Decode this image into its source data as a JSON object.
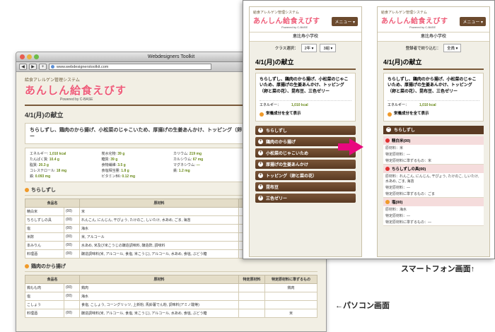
{
  "desktop": {
    "window_title": "Webdesigners Toolkit",
    "url": "www.webdesignerstoolkit.com",
    "logo_top": "給食アレルゲン管理システム",
    "logo": "あんしん給食えびす",
    "powered": "Powered by C-BASE",
    "headline": "4/1(月)の献立",
    "menu_text": "ちらしずし、鶏肉のから揚げ、小松菜のじゃこいため、厚揚げの生姜あんかけ、トッピング（卵と菜の花）、昆布豆、三色ゼリー",
    "nutrition": [
      {
        "label": "エネルギー:",
        "value": "1,010 kcal"
      },
      {
        "label": "炭水化物:",
        "value": "39 g"
      },
      {
        "label": "カリウム:",
        "value": "219 mg"
      },
      {
        "label": "ビタミンA当量:",
        "value": "175 IU"
      },
      {
        "label": "たんぱく質:",
        "value": "10.4 g"
      },
      {
        "label": "糖質:",
        "value": "39 g"
      },
      {
        "label": "カルシウム:",
        "value": "67 mg"
      },
      {
        "label": "ビタミンD:",
        "value": "6 IU"
      },
      {
        "label": "脂質:",
        "value": "20.3 g"
      },
      {
        "label": "食物繊維:",
        "value": "3.5 g"
      },
      {
        "label": "マグネシウム:",
        "value": "—"
      },
      {
        "label": "ビタミンB1:",
        "value": "0.23 mg"
      },
      {
        "label": "コレステロール:",
        "value": "18 mg"
      },
      {
        "label": "食塩相当量:",
        "value": "1.8 g"
      },
      {
        "label": "鉄:",
        "value": "1.2 mg"
      },
      {
        "label": "ビタミンB2:",
        "value": "0.11 mg"
      },
      {
        "label": "鉄:",
        "value": "0.093 mg"
      },
      {
        "label": "ビタミンB6:",
        "value": "0.12 mg"
      }
    ],
    "section1": "ちらしずし",
    "section2": "鶏肉のから揚げ",
    "table_headers": [
      "食品名",
      "原材料",
      "特定原材料",
      "特定原材料に準ずるもの"
    ],
    "table1_rows": [
      [
        "精白米",
        "(00)",
        "米",
        "",
        "米"
      ],
      [
        "ちらしずしの具",
        "(00)",
        "れんこん, にんじん, 干ぴょう, たけのこ, しいたけ, 水あめ, ごま, 海苔",
        "",
        "ごま"
      ],
      [
        "塩",
        "(00)",
        "海水",
        "",
        ""
      ],
      [
        "米酢",
        "(00)",
        "米, アルコール",
        "",
        "米"
      ],
      [
        "本みりん",
        "(00)",
        "水あめ, 米及び米こうじの醸造調味料, 醸造酢, 調味料",
        "",
        "米"
      ],
      [
        "料理酒",
        "(00)",
        "醸造調味料(米, アルコール, 食塩, 米こうじ), アルコール, 水あめ, 食塩, ぶどう糖",
        "",
        "米"
      ]
    ],
    "table2_rows": [
      [
        "鶏もも肉",
        "(00)",
        "鶏肉",
        "",
        "鶏肉"
      ],
      [
        "塩",
        "(00)",
        "海水",
        "",
        ""
      ],
      [
        "こしょう",
        "",
        "食塩, こしょう, コーングリッツ, 上新粉, 馬鈴薯でん粉, 調味料(アミノ酸等)",
        "",
        ""
      ],
      [
        "料理酒",
        "(00)",
        "醸造調味料(米, アルコール, 食塩, 米こうじ), アルコール, 水あめ, 食塩, ぶどう糖",
        "",
        "米"
      ]
    ]
  },
  "phone1": {
    "logo_top": "給食アレルゲン管理システム",
    "logo": "あんしん給食えびす",
    "powered": "Powered by C-BASE",
    "menu_button": "メニュー ▾",
    "school": "恵比寿小学校",
    "class_label": "クラス選択：",
    "grade": "2年 ▾",
    "class": "3組 ▾",
    "date": "4/1(月)の献立",
    "menu_text": "ちらしずし、鶏肉のから揚げ、小松菜のじゃこいため、厚揚げの生姜あんかけ、トッピング（卵と菜の花）、昆布豆、三色ゼリー",
    "energy_label": "エネルギー：",
    "energy_value": "1,010 kcal",
    "show_all": "栄養成分を全て表示",
    "dishes": [
      "ちらしずし",
      "鶏肉のから揚げ",
      "小松菜のじゃこいため",
      "厚揚げの生姜あんかけ",
      "トッピング（卵と菜の花）",
      "昆布豆",
      "三色ゼリー"
    ]
  },
  "phone2": {
    "logo_top": "給食アレルゲン管理システム",
    "logo": "あんしん給食えびす",
    "powered": "Powered by C-BASE",
    "menu_button": "メニュー ▾",
    "school": "恵比寿小学校",
    "filter_label": "登録者で絞り込む：",
    "filter": "全員 ▾",
    "date": "4/1(月)の献立",
    "menu_text": "ちらしずし、鶏肉のから揚げ、小松菜のじゃこいため、厚揚げの生姜あんかけ、トッピング（卵と菜の花）、昆布豆、三色ゼリー",
    "energy_label": "エネルギー：",
    "energy_value": "1,010 kcal",
    "show_all": "栄養成分を全て表示",
    "open_dish": "ちらしずし",
    "items": [
      {
        "name": "精白米(00)",
        "material": "原材料：米",
        "special": "特定原材料：—",
        "similar": "特定原材料に準ずるもの：米"
      },
      {
        "name": "ちらしずしの具(00)",
        "material": "原材料：れんこん, にんじん, 干ぴょう, たけのこ, しいたけ, 水あめ, ごま, 海苔",
        "special": "特定原材料：—",
        "similar": "特定原材料に準ずるもの：ごま"
      },
      {
        "name": "塩(00)",
        "material": "原材料：海水",
        "special": "特定原材料：—",
        "similar": "特定原材料に準ずるもの：—"
      }
    ]
  },
  "captions": {
    "smartphone": "スマートフォン画面↑",
    "pc": "←パソコン画面"
  }
}
